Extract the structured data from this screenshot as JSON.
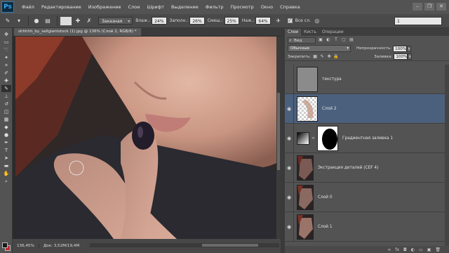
{
  "app": {
    "logo": "Ps"
  },
  "menu": [
    "Файл",
    "Редактирование",
    "Изображение",
    "Слои",
    "Шрифт",
    "Выделение",
    "Фильтр",
    "Просмотр",
    "Окно",
    "Справка"
  ],
  "options": {
    "mode_value": "Заказная",
    "vlazh_label": "Влаж.:",
    "vlazh_value": "24%",
    "zapoln_label": "Заполн.:",
    "zapoln_value": "26%",
    "smesh_label": "Смеш.:",
    "smesh_value": "25%",
    "nazh_label": "Наж.:",
    "nazh_value": "64%",
    "all_layers_label": "Все сл.",
    "all_layers_checked": true,
    "right_field_value": "1"
  },
  "document": {
    "tab_title": "shhhhh_by_sallgiantstock (1).jpg @ 136% (Слой 2, RGB/8) *",
    "zoom": "136,45%",
    "doc_size": "Док: 3,52M/19,4M"
  },
  "panel": {
    "tabs": [
      "Слои",
      "Кисть",
      "Операции"
    ],
    "active_tab": 0,
    "kind_label": "Вид",
    "blend_mode": "Обычные",
    "opacity_label": "Непрозрачность:",
    "opacity_value": "100%",
    "lock_label": "Закрепить:",
    "fill_label": "Заливка:",
    "fill_value": "100%"
  },
  "layers": [
    {
      "name": "текстура",
      "visible": false,
      "selected": false,
      "thumb": "gray"
    },
    {
      "name": "Слой 2",
      "visible": true,
      "selected": true,
      "thumb": "checker"
    },
    {
      "name": "Градиентная заливка 1",
      "visible": true,
      "selected": false,
      "thumb": "gradient"
    },
    {
      "name": "Экстракция деталей (CEF 4)",
      "visible": true,
      "selected": false,
      "thumb": "photo"
    },
    {
      "name": "Слой 0",
      "visible": true,
      "selected": false,
      "thumb": "photo"
    },
    {
      "name": "Слой 1",
      "visible": true,
      "selected": false,
      "thumb": "photo"
    }
  ],
  "colors": {
    "foreground": "#1a1a1a",
    "background": "#c2262a",
    "selected_layer": "#4b607d"
  }
}
